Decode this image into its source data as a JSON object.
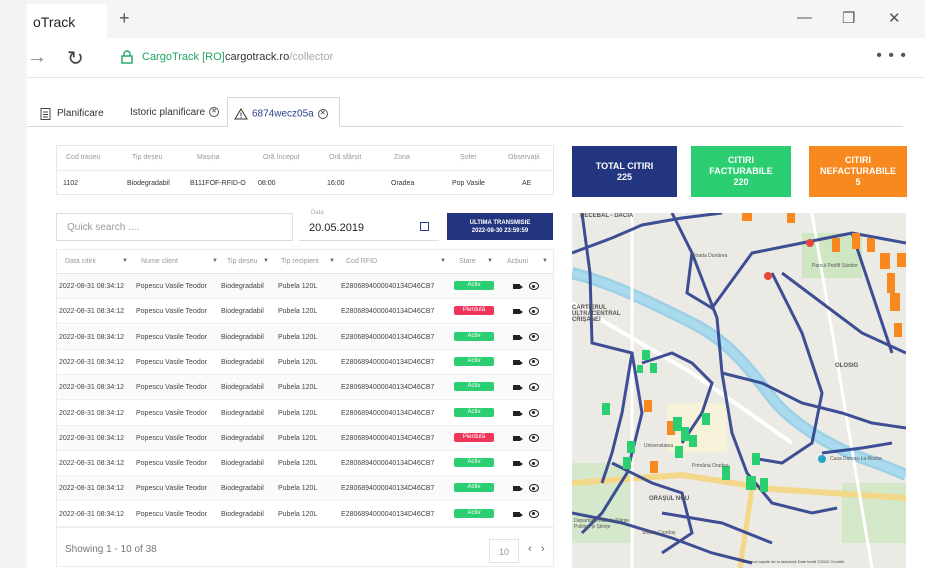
{
  "browser": {
    "tab_title": "oTrack",
    "new_tab": "+",
    "minimize": "—",
    "restore": "❐",
    "close": "✕",
    "back": "→",
    "reload": "↻",
    "site_name": "CargoTrack [RO]",
    "url_host": "cargotrack.ro",
    "url_path": "/collector",
    "more": "• • •"
  },
  "app_tabs": [
    {
      "label": "Planificare"
    },
    {
      "label": "Istoric planificare"
    },
    {
      "label": "6874wecz05a"
    }
  ],
  "info": {
    "headers": [
      "Cod traseu",
      "Tip deșeu",
      "Mașina",
      "Oră început",
      "Oră sfârșit",
      "Zona",
      "Șofer",
      "Observații"
    ],
    "values": [
      "1102",
      "Biodegradabil",
      "B111FOF-RFID-O",
      "08:00",
      "16:00",
      "Oradea",
      "Pop Vasile",
      "AE"
    ]
  },
  "cards": {
    "total": {
      "label": "TOTAL CITIRI",
      "value": "225",
      "color": "#24357f"
    },
    "billable": {
      "label": "CITIRI FACTURABILE",
      "value": "220",
      "color": "#2bcf71"
    },
    "non_billable": {
      "label": "CITIRI NEFACTURABILE",
      "value": "5",
      "color": "#f7891f"
    }
  },
  "search": {
    "placeholder": "Quick search ...."
  },
  "date": {
    "label": "Data",
    "value": "20.05.2019"
  },
  "transmission": {
    "label": "ULTIMA TRANSMISIE",
    "value": "2022-08-30 23:59:59"
  },
  "table": {
    "headers": [
      "Data citirii",
      "Nume client",
      "Tip deșeu",
      "Tip recipient",
      "Cod RFID",
      "Stare",
      "Acțiuni"
    ],
    "rows": [
      {
        "date": "2022-08-31 08:34:12",
        "client": "Popescu Vasile Teodor",
        "waste": "Biodegradabil",
        "container": "Pubela 120L",
        "rfid": "E2806894000040134D46CB7",
        "status": "Activ",
        "status_color": "#2bcf71"
      },
      {
        "date": "2022-08-31 08:34:12",
        "client": "Popescu Vasile Teodor",
        "waste": "Biodegradabil",
        "container": "Pubela 120L",
        "rfid": "E2806894000040134D46CB7",
        "status": "Pierdută",
        "status_color": "#f0355a"
      },
      {
        "date": "2022-08-31 08:34:12",
        "client": "Popescu Vasile Teodor",
        "waste": "Biodegradabil",
        "container": "Pubela 120L",
        "rfid": "E2806894000040134D46CB7",
        "status": "Activ",
        "status_color": "#2bcf71"
      },
      {
        "date": "2022-08-31 08:34:12",
        "client": "Popescu Vasile Teodor",
        "waste": "Biodegradabil",
        "container": "Pubela 120L",
        "rfid": "E2806894000040134D46CB7",
        "status": "Activ",
        "status_color": "#2bcf71"
      },
      {
        "date": "2022-08-31 08:34:12",
        "client": "Popescu Vasile Teodor",
        "waste": "Biodegradabil",
        "container": "Pubela 120L",
        "rfid": "E2806894000040134D46CB7",
        "status": "Activ",
        "status_color": "#2bcf71"
      },
      {
        "date": "2022-08-31 08:34:12",
        "client": "Popescu Vasile Teodor",
        "waste": "Biodegradabil",
        "container": "Pubela 120L",
        "rfid": "E2806894000040134D46CB7",
        "status": "Activ",
        "status_color": "#2bcf71"
      },
      {
        "date": "2022-08-31 08:34:12",
        "client": "Popescu Vasile Teodor",
        "waste": "Biodegradabil",
        "container": "Pubela 120L",
        "rfid": "E2806894000040134D46CB7",
        "status": "Pierdută",
        "status_color": "#f0355a"
      },
      {
        "date": "2022-08-31 08:34:12",
        "client": "Popescu Vasile Teodor",
        "waste": "Biodegradabil",
        "container": "Pubela 120L",
        "rfid": "E2806894000040134D46CB7",
        "status": "Activ",
        "status_color": "#2bcf71"
      },
      {
        "date": "2022-08-31 08:34:12",
        "client": "Popescu Vasile Teodor",
        "waste": "Biodegradabil",
        "container": "Pubela 120L",
        "rfid": "E2806894000040134D46CB7",
        "status": "Activ",
        "status_color": "#2bcf71"
      },
      {
        "date": "2022-08-31 08:34:12",
        "client": "Popescu Vasile Teodor",
        "waste": "Biodegradabil",
        "container": "Pubela 120L",
        "rfid": "E2806894000040134D46CB7",
        "status": "Activ",
        "status_color": "#2bcf71"
      }
    ]
  },
  "pagination": {
    "showing": "Showing 1 - 10 of 38",
    "page_size": "10",
    "prev": "‹",
    "next": "›"
  },
  "map": {
    "labels": [
      "DECEBAL - DACIA",
      "CARTIERUL ULTRACENTRAL CRIȘANEI",
      "ORAȘUL NOU",
      "OLOSIG",
      "Universitatea",
      "Primăria Oradea",
      "Casa Darvas-La Roche",
      "Parcul Petőfi Sándor",
      "Departamentul de Științe Politice și Științe",
      "Strada Ciordaș",
      "Strada Dunărea"
    ],
    "attribution": "Comenzi rapide de la tastatură   Date hartă ©2022   Condiții"
  }
}
